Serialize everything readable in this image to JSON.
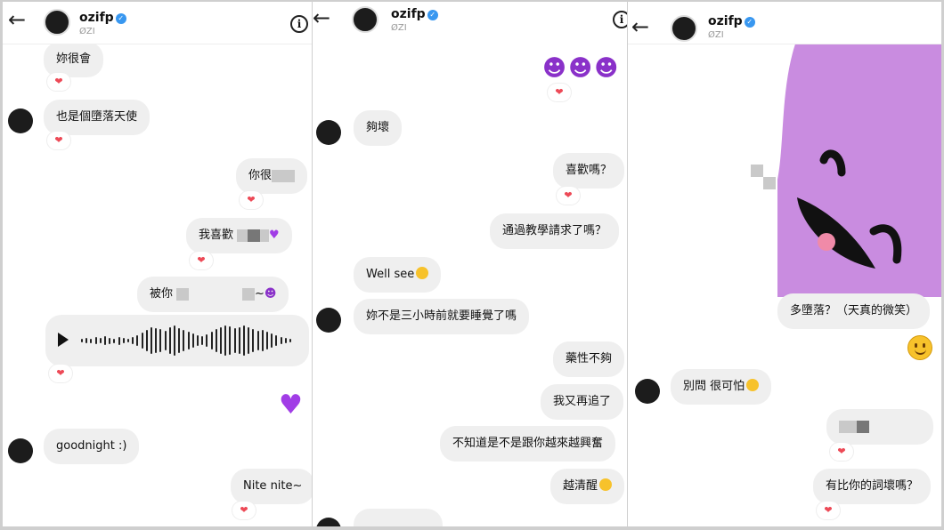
{
  "header": {
    "username": "ozifp",
    "subtitle": "ØZI",
    "verified_mark": "✓",
    "back_icon": "←",
    "info_icon": "i"
  },
  "reaction": "❤",
  "panel1": {
    "messages": [
      "妳很會",
      "也是個墮落天使",
      "你很",
      "我喜歡",
      "被你",
      "goodnight :)",
      "Nite nite~"
    ],
    "trailing": [
      "~"
    ]
  },
  "panel2": {
    "messages": [
      "夠壞",
      "喜歡嗎？",
      "通過教學請求了嗎？",
      "Well see",
      "妳不是三小時前就要睡覺了嗎",
      "藥性不夠",
      "我又再追了",
      "不知道是不是跟你越來越興奮",
      "越清醒"
    ]
  },
  "panel3": {
    "messages": [
      "多墮落？（天真的微笑）",
      "別問 很可怕",
      "有比你的詞壞嗎？"
    ]
  },
  "colors": {
    "bubble": "#efefef",
    "heart": "#ed4956",
    "sticker": "#c98ce0",
    "verified": "#3897f0"
  }
}
